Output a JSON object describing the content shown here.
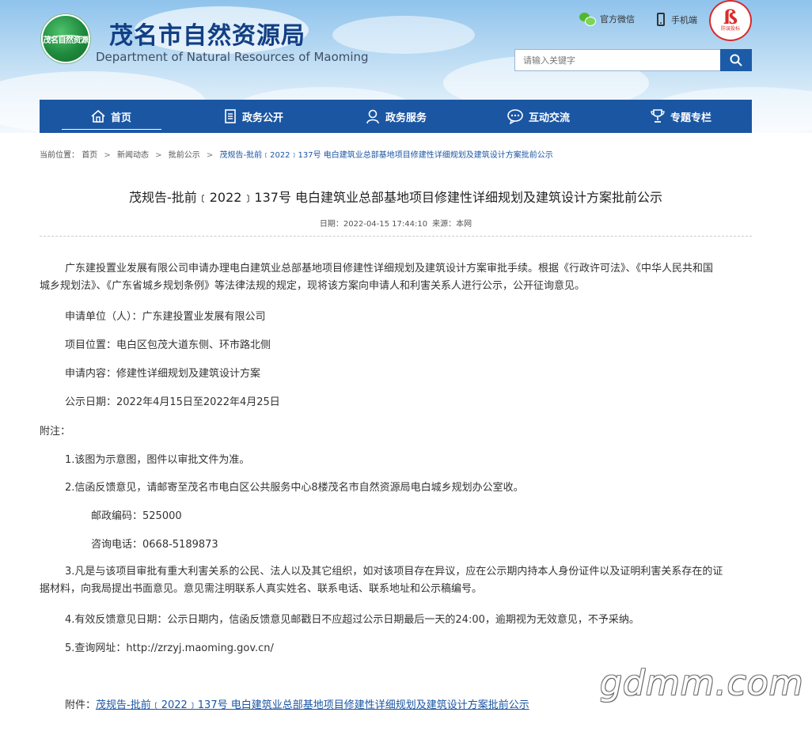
{
  "header": {
    "logo_text": "茂名自然资源",
    "title": "茂名市自然资源局",
    "subtitle": "Department of Natural Resources of Maoming",
    "wechat_label": "官方微信",
    "mobile_label": "手机端",
    "seal_mark": "ß",
    "seal_text": "防误投标"
  },
  "search": {
    "placeholder": "请输入关键字",
    "value": ""
  },
  "nav": {
    "items": [
      {
        "label": "首页",
        "icon": "home-icon"
      },
      {
        "label": "政务公开",
        "icon": "document-icon"
      },
      {
        "label": "政务服务",
        "icon": "service-person-icon"
      },
      {
        "label": "互动交流",
        "icon": "chat-bubble-icon"
      },
      {
        "label": "专题专栏",
        "icon": "trophy-icon"
      }
    ],
    "active_index": 0
  },
  "breadcrumb": {
    "prefix": "当前位置：",
    "items": [
      "首页",
      "新闻动态",
      "批前公示"
    ],
    "separator": ">",
    "current": "茂规告-批前﹝2022﹞137号 电白建筑业总部基地项目修建性详细规划及建筑设计方案批前公示"
  },
  "article": {
    "title": "茂规告-批前﹝2022﹞137号 电白建筑业总部基地项目修建性详细规划及建筑设计方案批前公示",
    "date_label": "日期：",
    "date": "2022-04-15 17:44:10",
    "source_label": "来源：",
    "source": "本网",
    "intro_line1": "广东建投置业发展有限公司申请办理电白建筑业总部基地项目修建性详细规划及建筑设计方案审批手续。根据《行政许可法》、《中华人民共和国",
    "intro_line2": "城乡规划法》、《广东省城乡规划条例》等法律法规的规定，现将该方案向申请人和利害关系人进行公示，公开征询意见。",
    "applicant": "申请单位（人）：广东建投置业发展有限公司",
    "location": "项目位置：电白区包茂大道东侧、环市路北侧",
    "content": "申请内容：修建性详细规划及建筑设计方案",
    "period": "公示日期：2022年4月15日至2022年4月25日",
    "notes_heading": "附注：",
    "note1": "1.该图为示意图，图件以审批文件为准。",
    "note2": "2.信函反馈意见，请邮寄至茂名市电白区公共服务中心8楼茂名市自然资源局电白城乡规划办公室收。",
    "postcode": "邮政编码：525000",
    "phone": "咨询电话：0668-5189873",
    "note3_line1": "3.凡是与该项目审批有重大利害关系的公民、法人以及其它组织，如对该项目存在异议，应在公示期内持本人身份证件以及证明利害关系存在的证",
    "note3_line2": "据材料，向我局提出书面意见。意见需注明联系人真实姓名、联系电话、联系地址和公示稿编号。",
    "note4": "4.有效反馈意见日期：公示日期内，信函反馈意见邮戳日不应超过公示日期最后一天的24:00，逾期视为无效意见，不予采纳。",
    "note5": "5.查询网址：http://zrzyj.maoming.gov.cn/",
    "attachment_label": "附件：",
    "attachment_link": "茂规告-批前﹝2022﹞137号 电白建筑业总部基地项目修建性详细规划及建筑设计方案批前公示"
  },
  "watermark": "gdmm.com",
  "colors": {
    "nav_bg": "#1b56a3",
    "title_blue": "#123f84",
    "link_blue": "#1b56a3",
    "search_btn": "#1c5ba8",
    "seal_red": "#d92b2b"
  }
}
